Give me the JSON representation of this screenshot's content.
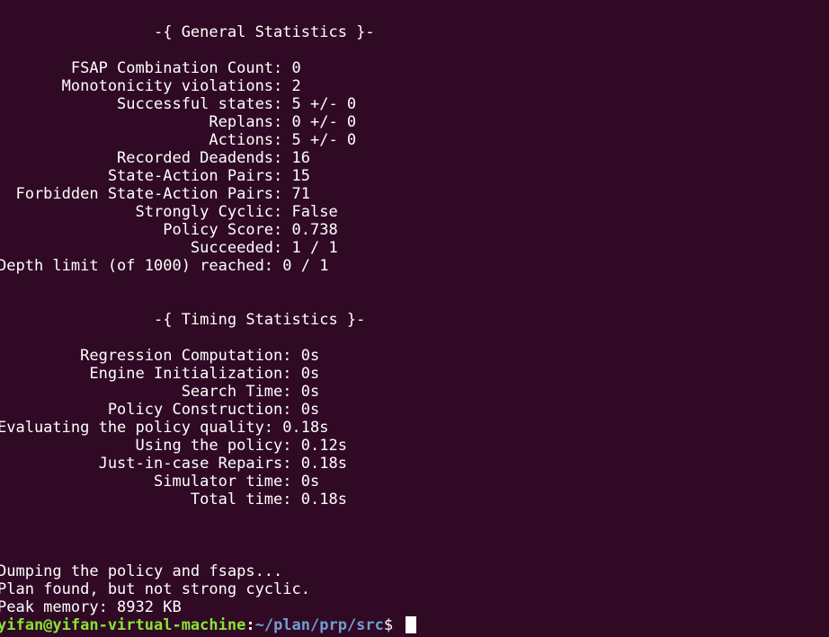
{
  "general": {
    "header": "                 -{ General Statistics }-",
    "rows": [
      "        FSAP Combination Count: 0",
      "       Monotonicity violations: 2",
      "             Successful states: 5 +/- 0",
      "                       Replans: 0 +/- 0",
      "                       Actions: 5 +/- 0",
      "             Recorded Deadends: 16",
      "            State-Action Pairs: 15",
      "  Forbidden State-Action Pairs: 71",
      "               Strongly Cyclic: False",
      "                  Policy Score: 0.738",
      "                     Succeeded: 1 / 1",
      "Depth limit (of 1000) reached: 0 / 1"
    ]
  },
  "timing": {
    "header": "                 -{ Timing Statistics }-",
    "rows": [
      "         Regression Computation: 0s",
      "          Engine Initialization: 0s",
      "                    Search Time: 0s",
      "            Policy Construction: 0s",
      "Evaluating the policy quality: 0.18s",
      "               Using the policy: 0.12s",
      "           Just-in-case Repairs: 0.18s",
      "                 Simulator time: 0s",
      "                     Total time: 0.18s"
    ]
  },
  "messages": [
    "Dumping the policy and fsaps...",
    "Plan found, but not strong cyclic.",
    "Peak memory: 8932 KB"
  ],
  "prompt": {
    "user_host": "yifan@yifan-virtual-machine",
    "colon": ":",
    "path": "~/plan/prp/src",
    "sigil": "$ "
  },
  "colors": {
    "background": "#300a24",
    "text": "#ffffff",
    "prompt_user": "#8ae234",
    "prompt_path": "#729fcf"
  }
}
